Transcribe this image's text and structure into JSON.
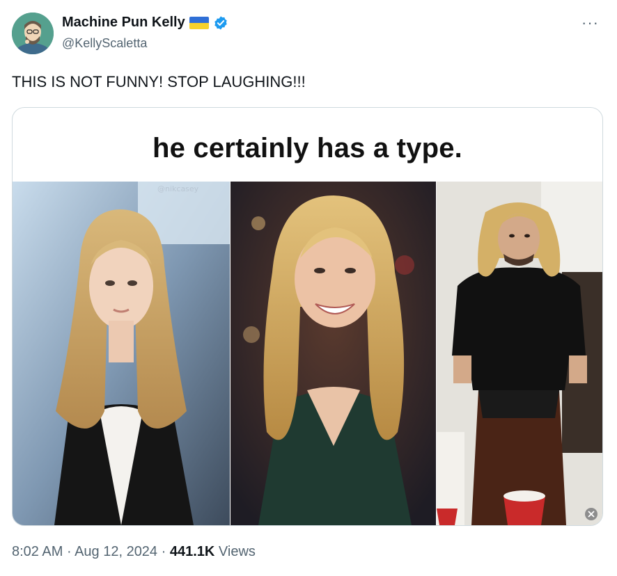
{
  "tweet": {
    "author_name": "Machine Pun Kelly",
    "handle": "@KellyScaletta",
    "text": "THIS IS NOT FUNNY! STOP LAUGHING!!!",
    "more_label": "···",
    "media_caption": "he certainly has a type.",
    "time": "8:02 AM",
    "separator": " · ",
    "date": "Aug 12, 2024",
    "views_count": "441.1K",
    "views_label": " Views",
    "icons": {
      "avatar": "avatar-illustration",
      "flag": "ukraine-flag-icon",
      "verified": "verified-badge-icon",
      "more": "more-options-icon",
      "media_close": "close-icon"
    },
    "colors": {
      "verified": "#1d9bf0",
      "flag_top": "#2f6fd6",
      "flag_bottom": "#f7d22a",
      "secondary_text": "#536471"
    }
  }
}
